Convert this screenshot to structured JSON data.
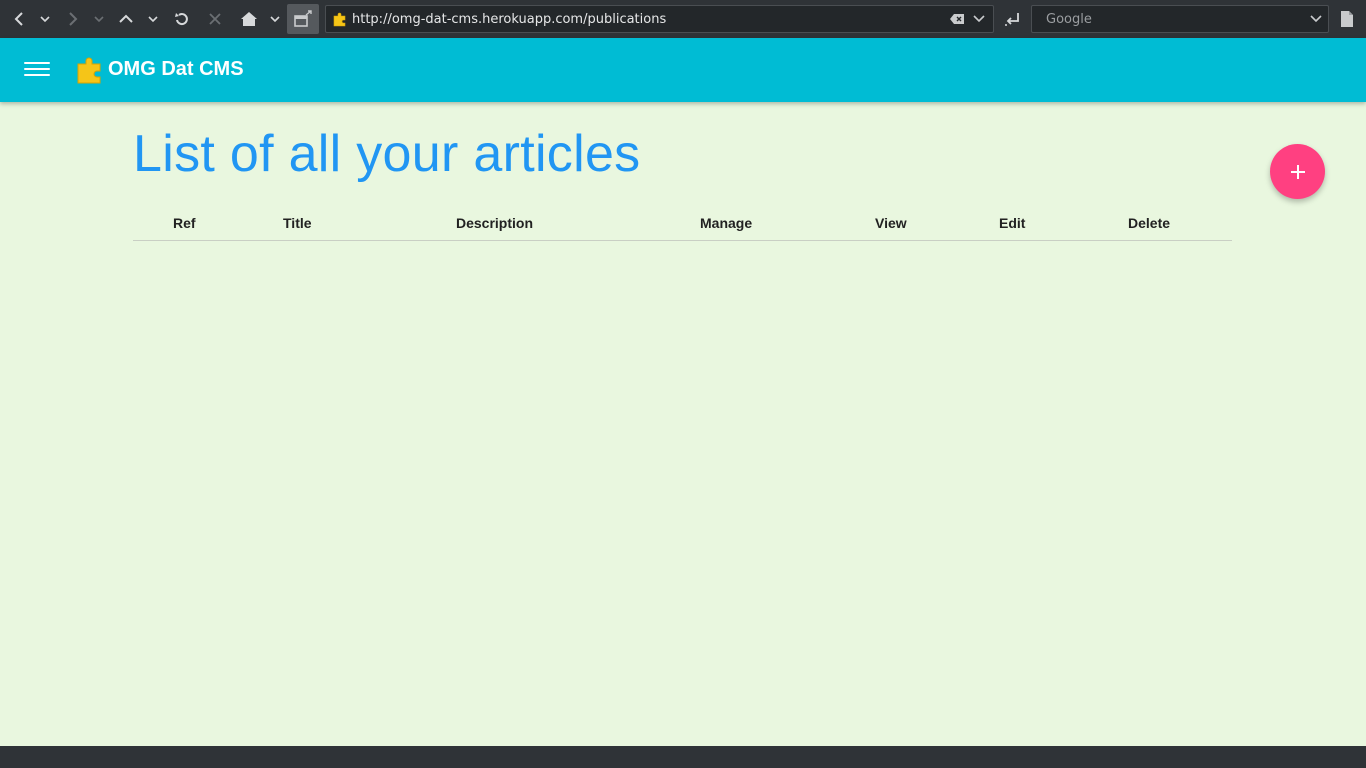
{
  "browser": {
    "url": "http://omg-dat-cms.herokuapp.com/publications",
    "search_placeholder": "Google"
  },
  "app": {
    "title": "OMG Dat CMS"
  },
  "main": {
    "heading": "List of all your articles",
    "add_button_symbol": "+",
    "columns": [
      "Ref",
      "Title",
      "Description",
      "Manage",
      "View",
      "Edit",
      "Delete"
    ],
    "rows": []
  },
  "colors": {
    "header_bg": "#00bcd4",
    "heading": "#2196f3",
    "fab": "#ff4081",
    "page_bg": "#e9f7df"
  },
  "icons": [
    "back-icon",
    "forward-icon",
    "up-icon",
    "reload-icon",
    "stop-icon",
    "home-icon",
    "window-icon",
    "puzzle-icon",
    "clear-icon",
    "dropdown-icon",
    "enter-icon",
    "page-icon",
    "menu-icon",
    "plus-icon"
  ]
}
